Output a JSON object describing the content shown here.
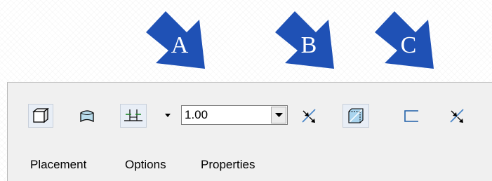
{
  "callouts": [
    {
      "letter": "A",
      "color": "#1f51b5"
    },
    {
      "letter": "B",
      "color": "#1f51b5"
    },
    {
      "letter": "C",
      "color": "#1f51b5"
    }
  ],
  "toolbar": {
    "tools": [
      {
        "name": "placement-solid-icon",
        "pressed": true
      },
      {
        "name": "placement-surface-icon",
        "pressed": false
      },
      {
        "name": "sketch-sweep-icon",
        "pressed": true
      },
      {
        "name": "depth-options-dropdown-icon"
      },
      {
        "name": "flip-direction-icon"
      },
      {
        "name": "thicken-sketch-icon",
        "pressed": true
      },
      {
        "name": "open-profile-icon",
        "pressed": false
      },
      {
        "name": "flip-thickness-icon"
      }
    ],
    "depth_value": "1.00",
    "tabs": [
      "Placement",
      "Options",
      "Properties"
    ]
  }
}
